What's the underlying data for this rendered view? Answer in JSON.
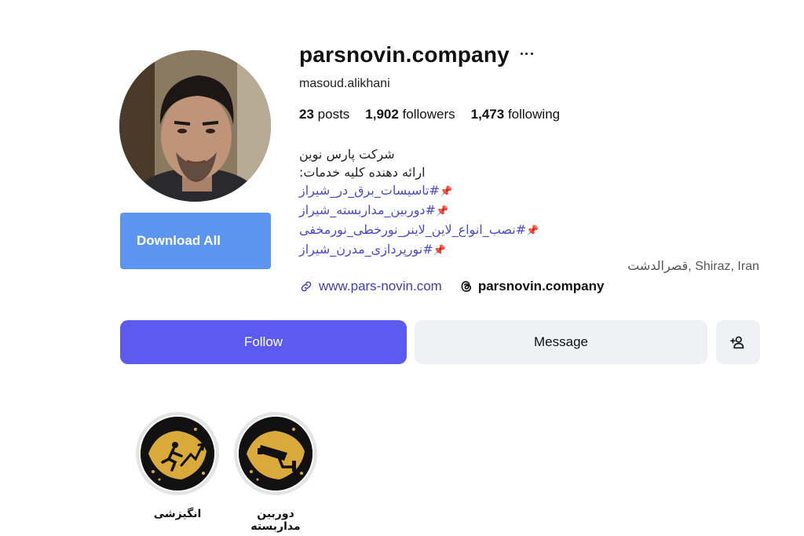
{
  "profile": {
    "username": "parsnovin.company",
    "full_name": "masoud.alikhani",
    "download_label": "Download All",
    "stats": {
      "posts_count": "23",
      "posts_label": "posts",
      "followers_count": "1,902",
      "followers_label": "followers",
      "following_count": "1,473",
      "following_label": "following"
    },
    "bio": {
      "line1": "شرکت پارس نوین",
      "line2": "ارائه دهنده کلیه خدمات:",
      "hashtags": [
        "#تاسیسات_برق_در_شیراز",
        "#دوربین_مداربسته_شیراز",
        "#نصب_انواع_لاین_لاینر_نورخطی_نورمخفی",
        "#نورپردازی_مدرن_شیراز"
      ]
    },
    "location": "قصرالدشت, Shiraz, Iran",
    "website": "www.pars-novin.com",
    "threads_handle": "parsnovin.company"
  },
  "actions": {
    "follow_label": "Follow",
    "message_label": "Message"
  },
  "highlights": [
    {
      "label": "دوربین مداربسته",
      "icon": "cctv-camera-icon"
    },
    {
      "label": "انگیزشی",
      "icon": "running-man-icon"
    }
  ],
  "colors": {
    "follow_bg": "#5b5bef",
    "download_bg": "#5b95ef",
    "link": "#3f3fb8",
    "secondary_bg": "#eff1f4",
    "highlight_gold": "#d9a93a"
  }
}
